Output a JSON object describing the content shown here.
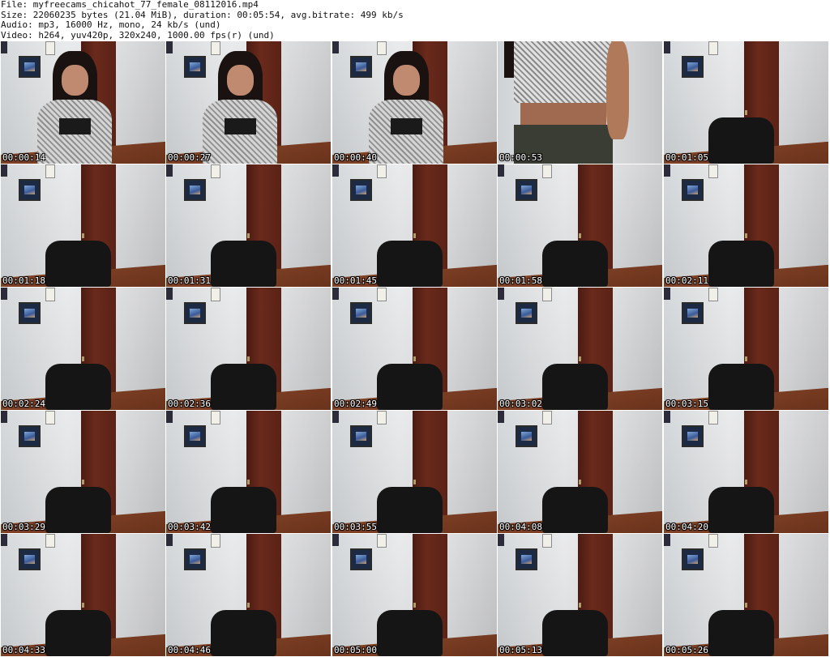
{
  "header": {
    "file_line": "File: myfreecams_chicahot_77_female_08112016.mp4",
    "size_line": "Size: 22060235 bytes (21.04 MiB), duration: 00:05:54, avg.bitrate: 499 kb/s",
    "audio_line": "Audio: mp3, 16000 Hz, mono, 24 kb/s (und)",
    "video_line": "Video: h264, yuv420p, 320x240, 1000.00 fps(r) (und)"
  },
  "thumbnails": [
    {
      "timestamp": "00:00:14",
      "scene": "person-phone"
    },
    {
      "timestamp": "00:00:27",
      "scene": "person-call"
    },
    {
      "timestamp": "00:00:40",
      "scene": "person-call"
    },
    {
      "timestamp": "00:00:53",
      "scene": "torso"
    },
    {
      "timestamp": "00:01:05",
      "scene": "empty-chair"
    },
    {
      "timestamp": "00:01:18",
      "scene": "empty-chair"
    },
    {
      "timestamp": "00:01:31",
      "scene": "empty-chair"
    },
    {
      "timestamp": "00:01:45",
      "scene": "empty-chair"
    },
    {
      "timestamp": "00:01:58",
      "scene": "empty-chair"
    },
    {
      "timestamp": "00:02:11",
      "scene": "empty-chair"
    },
    {
      "timestamp": "00:02:24",
      "scene": "empty-chair"
    },
    {
      "timestamp": "00:02:36",
      "scene": "empty-chair"
    },
    {
      "timestamp": "00:02:49",
      "scene": "empty-chair"
    },
    {
      "timestamp": "00:03:02",
      "scene": "empty-chair"
    },
    {
      "timestamp": "00:03:15",
      "scene": "empty-chair"
    },
    {
      "timestamp": "00:03:29",
      "scene": "empty-chair"
    },
    {
      "timestamp": "00:03:42",
      "scene": "empty-chair"
    },
    {
      "timestamp": "00:03:55",
      "scene": "empty-chair"
    },
    {
      "timestamp": "00:04:08",
      "scene": "empty-chair"
    },
    {
      "timestamp": "00:04:20",
      "scene": "empty-chair"
    },
    {
      "timestamp": "00:04:33",
      "scene": "empty-chair"
    },
    {
      "timestamp": "00:04:46",
      "scene": "empty-chair"
    },
    {
      "timestamp": "00:05:00",
      "scene": "empty-chair"
    },
    {
      "timestamp": "00:05:13",
      "scene": "empty-chair"
    },
    {
      "timestamp": "00:05:26",
      "scene": "empty-chair"
    }
  ]
}
